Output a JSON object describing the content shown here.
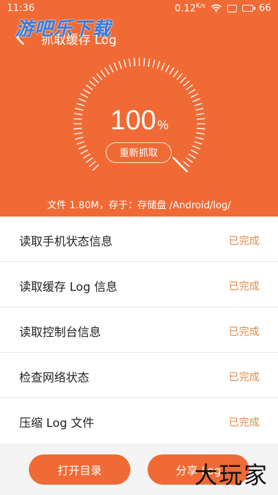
{
  "status_bar": {
    "time": "11:36",
    "speed": "0.12",
    "speed_unit": "K/s",
    "battery": "66"
  },
  "watermark_top": "游吧乐下载",
  "watermark_bottom": "大玩家",
  "header": {
    "title": "抓取缓存 Log",
    "progress_value": "100",
    "progress_unit": "%",
    "recapture_label": "重新抓取",
    "file_info": "文件 1.80M，存于：存储盘 /Android/log/",
    "progress_fraction": 1.0
  },
  "tasks": [
    {
      "label": "读取手机状态信息",
      "status": "已完成"
    },
    {
      "label": "读取缓存 Log 信息",
      "status": "已完成"
    },
    {
      "label": "读取控制台信息",
      "status": "已完成"
    },
    {
      "label": "检查网络状态",
      "status": "已完成"
    },
    {
      "label": "压缩 Log 文件",
      "status": "已完成"
    }
  ],
  "actions": {
    "open_dir": "打开目录",
    "share": "分享 Log"
  },
  "colors": {
    "accent": "#f06a35",
    "status_done": "#e08a47"
  }
}
